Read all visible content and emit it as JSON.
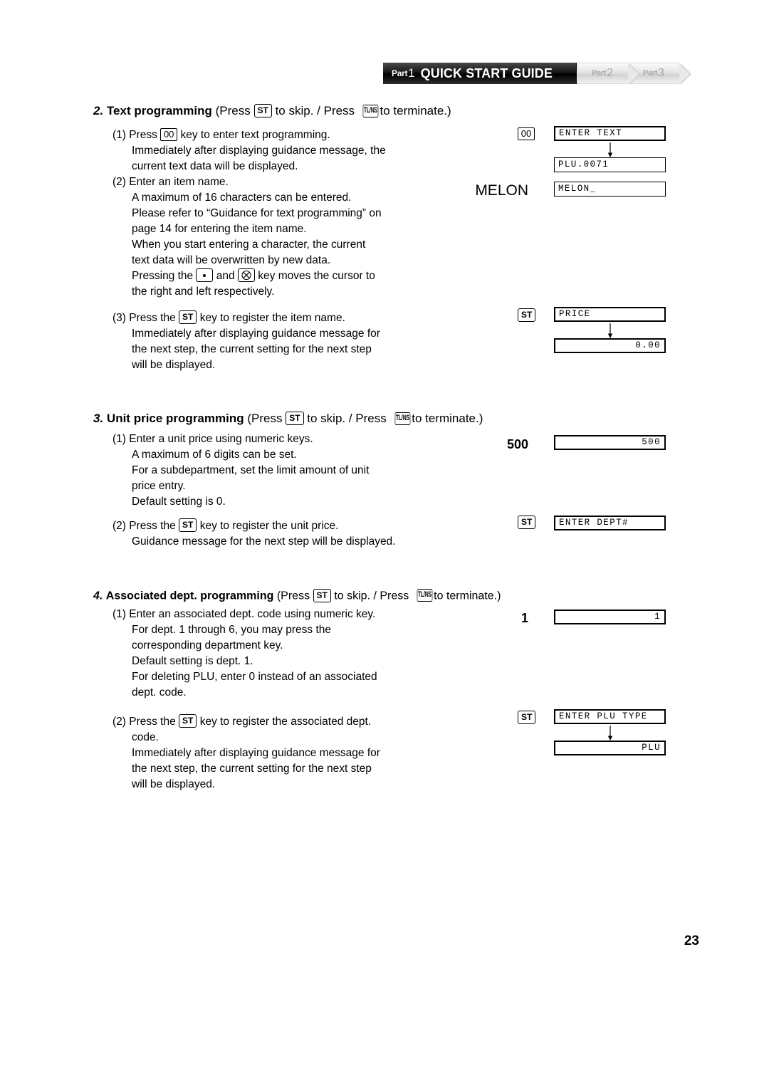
{
  "header": {
    "part_word": "Part",
    "active": {
      "num": "1",
      "title": "QUICK START GUIDE"
    },
    "tabs": [
      {
        "word": "Part",
        "num": "2"
      },
      {
        "word": "Part",
        "num": "3"
      }
    ]
  },
  "keys": {
    "st": "ST",
    "tlns": "TL/NS",
    "zero_zero": "00"
  },
  "sections": [
    {
      "num": "2.",
      "name": "Text programming",
      "note_a": "(Press",
      "note_b": "to skip. / Press",
      "note_c": "to terminate.)",
      "lines": [
        "(1) Press",
        "key to enter text programming.",
        "Immediately after displaying guidance message, the",
        "current text data will be displayed.",
        "(2) Enter an item name.",
        "A maximum of 16 characters can be entered.",
        "Please refer to “Guidance for text programming” on",
        "page 14 for entering the item name.",
        "When you start entering a character, the current",
        "text data will be overwritten by new data.",
        "Pressing the",
        "and",
        "key moves the cursor to",
        "the right and left respectively.",
        "(3) Press the",
        "key to register the item name.",
        "Immediately after displaying guidance message for",
        "the next step, the current setting for the next step",
        "will be displayed."
      ]
    },
    {
      "num": "3.",
      "name": "Unit price programming",
      "note_a": "(Press",
      "note_b": "to skip. / Press",
      "note_c": "to terminate.)",
      "lines": [
        "(1) Enter a unit price using numeric keys.",
        "A maximum of 6 digits can be set.",
        "For a subdepartment, set the limit amount of unit",
        "price entry.",
        "Default setting is 0.",
        "(2) Press the",
        "key to register the unit price.",
        "Guidance message for the next step will be displayed."
      ]
    },
    {
      "num": "4.",
      "name": "Associated dept. programming",
      "note_a": "(Press",
      "note_b": "to skip. / Press",
      "note_c": "to terminate.)",
      "lines": [
        "(1) Enter an associated dept. code using numeric key.",
        "For dept. 1 through 6, you may press the",
        "corresponding department key.",
        "Default setting is dept. 1.",
        "For deleting PLU, enter 0 instead of an associated",
        "dept. code.",
        "(2) Press the",
        "key to register the associated dept.",
        "code.",
        "Immediately after displaying guidance message for",
        "the next step, the current setting for the next step",
        "will be displayed."
      ]
    }
  ],
  "displays": {
    "entry_melon": "MELON",
    "entry_500": "500",
    "entry_1": "1",
    "lcd_enter_text": "ENTER TEXT",
    "lcd_plu_0071": "PLU.0071",
    "lcd_melon_cursor": "MELON_",
    "lcd_price": "PRICE",
    "lcd_zero": "0.00",
    "lcd_500": "500",
    "lcd_enter_dept": "ENTER DEPT#",
    "lcd_1": "1",
    "lcd_enter_plu_type": "ENTER PLU TYPE",
    "lcd_plu": "PLU"
  },
  "footer": {
    "page_number": "23"
  }
}
